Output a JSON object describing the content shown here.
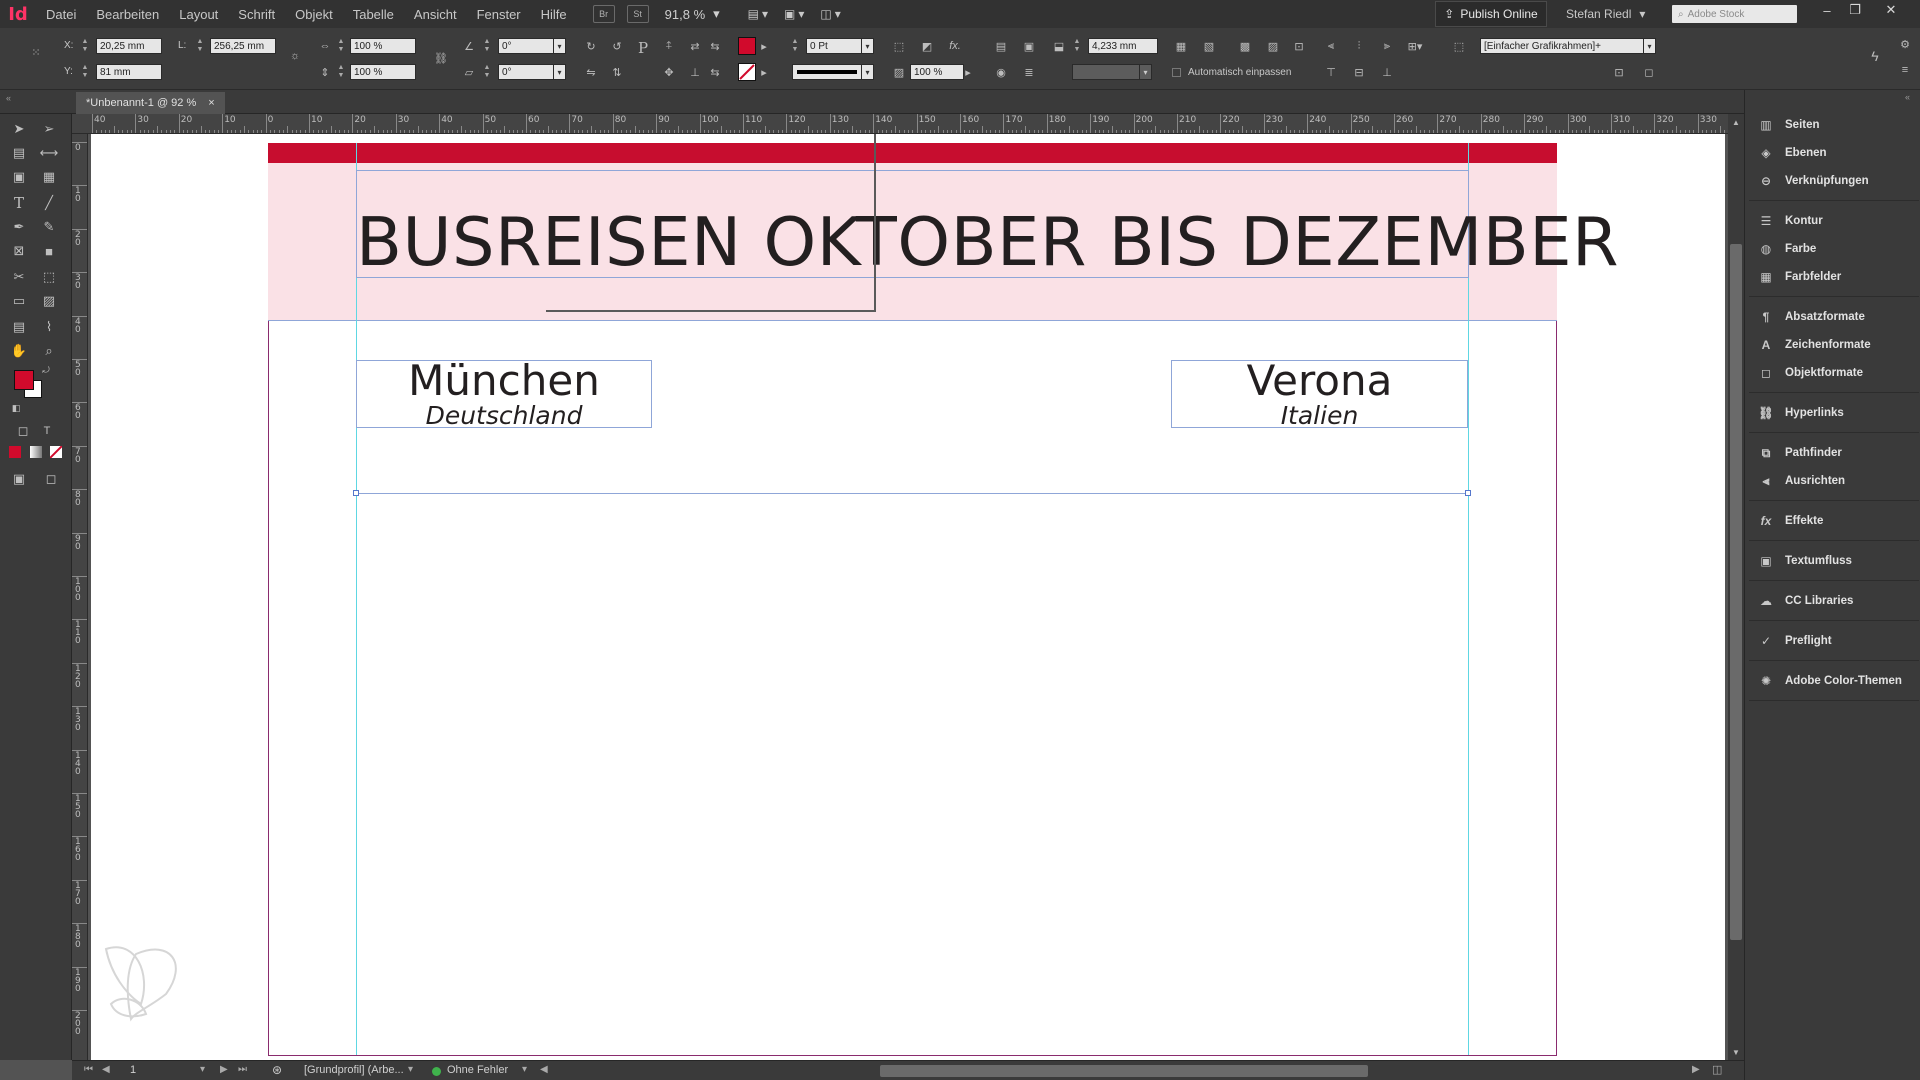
{
  "app": {
    "logo": "Id"
  },
  "menu": [
    "Datei",
    "Bearbeiten",
    "Layout",
    "Schrift",
    "Objekt",
    "Tabelle",
    "Ansicht",
    "Fenster",
    "Hilfe"
  ],
  "menubar_icons": {
    "bridge": "Br",
    "stock": "St"
  },
  "zoom": {
    "value": "91,8 %"
  },
  "publish": {
    "label": "Publish Online"
  },
  "user": {
    "name": "Stefan Riedl"
  },
  "search": {
    "placeholder": "Adobe Stock"
  },
  "control": {
    "x_label": "X:",
    "x_value": "20,25 mm",
    "y_label": "Y:",
    "y_value": "81 mm",
    "w_label": "L:",
    "w_value": "256,25 mm",
    "scale_x": "100 %",
    "scale_y": "100 %",
    "rotate": "0°",
    "shear": "0°",
    "stroke_weight": "0 Pt",
    "opacity": "100 %",
    "dimension": "4,233 mm",
    "frame_style": "[Einfacher Grafikrahmen]+",
    "auto_fit_label": "Automatisch einpassen",
    "fill_color": "#d10a2c"
  },
  "document_tab": {
    "title": "*Unbenannt-1 @ 92 %",
    "close": "×"
  },
  "ruler": {
    "h_ticks": [
      "40",
      "30",
      "20",
      "10",
      "0",
      "10",
      "20",
      "30",
      "40",
      "50",
      "60",
      "70",
      "80",
      "90",
      "100",
      "110",
      "120",
      "130",
      "140",
      "150",
      "160",
      "170",
      "180",
      "190",
      "200",
      "210",
      "220",
      "230",
      "240",
      "250",
      "260",
      "270",
      "280",
      "290",
      "300",
      "310",
      "320",
      "330"
    ],
    "v_ticks": [
      "0",
      "1 0",
      "2 0",
      "3 0",
      "4 0",
      "5 0",
      "6 0",
      "7 0",
      "8 0",
      "9 0",
      "1 0 0",
      "1 1 0",
      "1 2 0",
      "1 3 0",
      "1 4 0",
      "1 5 0",
      "1 6 0",
      "1 7 0",
      "1 8 0",
      "1 9 0",
      "2 0 0"
    ]
  },
  "document": {
    "title": "BUSREISEN OKTOBER BIS DEZEMBER",
    "city_left": "München",
    "country_left": "Deutschland",
    "city_right": "Verona",
    "country_right": "Italien",
    "accent_color": "#c70d2f",
    "band_color": "#fae1e6"
  },
  "panels": [
    {
      "label": "Seiten",
      "icon": "pages-icon"
    },
    {
      "label": "Ebenen",
      "icon": "layers-icon"
    },
    {
      "label": "Verknüpfungen",
      "icon": "links-icon"
    },
    {
      "label": "Kontur",
      "icon": "stroke-icon"
    },
    {
      "label": "Farbe",
      "icon": "color-icon"
    },
    {
      "label": "Farbfelder",
      "icon": "swatches-icon"
    },
    {
      "label": "Absatzformate",
      "icon": "paragraph-styles-icon"
    },
    {
      "label": "Zeichenformate",
      "icon": "character-styles-icon"
    },
    {
      "label": "Objektformate",
      "icon": "object-styles-icon"
    },
    {
      "label": "Hyperlinks",
      "icon": "hyperlinks-icon"
    },
    {
      "label": "Pathfinder",
      "icon": "pathfinder-icon"
    },
    {
      "label": "Ausrichten",
      "icon": "align-icon"
    },
    {
      "label": "Effekte",
      "icon": "effects-icon"
    },
    {
      "label": "Textumfluss",
      "icon": "text-wrap-icon"
    },
    {
      "label": "CC Libraries",
      "icon": "cc-libraries-icon"
    },
    {
      "label": "Preflight",
      "icon": "preflight-icon"
    },
    {
      "label": "Adobe Color-Themen",
      "icon": "adobe-color-icon"
    }
  ],
  "status": {
    "page": "1",
    "profile": "[Grundprofil] (Arbe...",
    "preflight": "Ohne Fehler"
  }
}
